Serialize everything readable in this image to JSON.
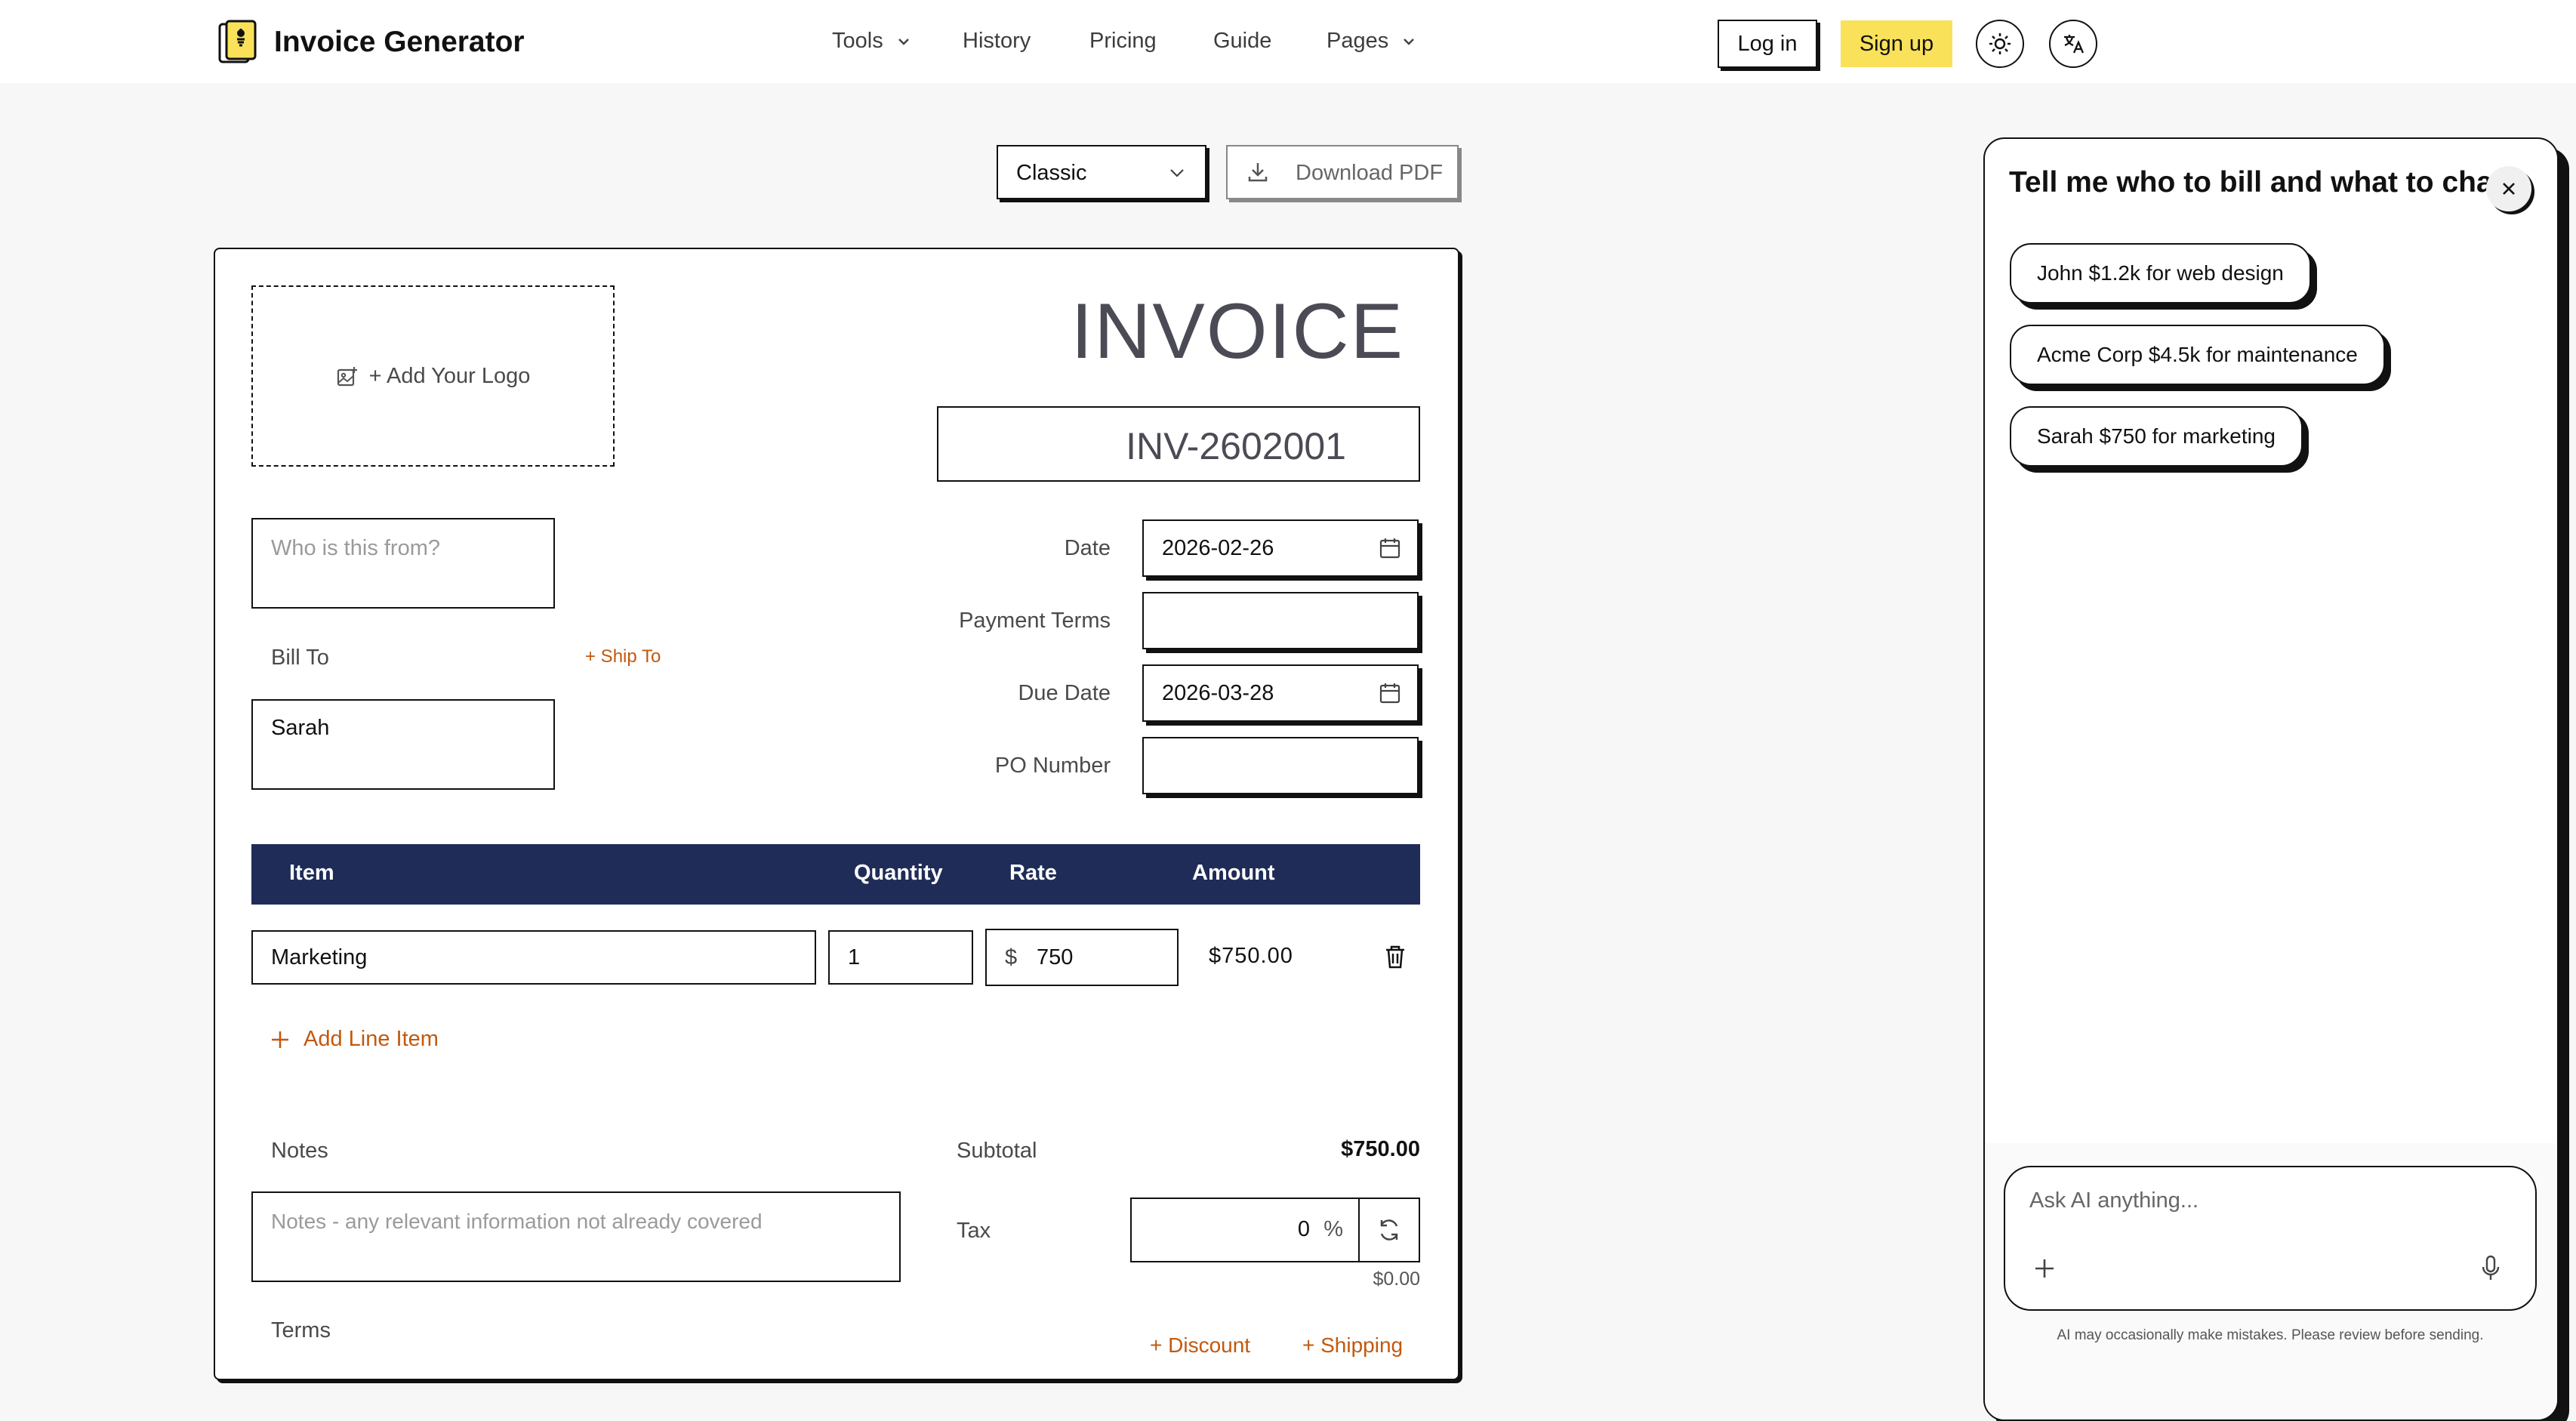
{
  "brand": {
    "name": "Invoice Generator"
  },
  "nav": {
    "items": [
      {
        "label": "Tools",
        "dropdown": true
      },
      {
        "label": "History",
        "dropdown": false
      },
      {
        "label": "Pricing",
        "dropdown": false
      },
      {
        "label": "Guide",
        "dropdown": false
      },
      {
        "label": "Pages",
        "dropdown": true
      }
    ],
    "login_label": "Log in",
    "signup_label": "Sign up",
    "theme_icon": "sun-icon",
    "language_icon": "translate-icon"
  },
  "toolbar": {
    "template_selected": "Classic",
    "download_label": "Download PDF"
  },
  "invoice": {
    "heading": "INVOICE",
    "number": "INV-2602001",
    "logo_label": "+ Add Your Logo",
    "from_placeholder": "Who is this from?",
    "bill_to_label": "Bill To",
    "ship_to_label": "+ Ship To",
    "bill_to_value": "Sarah",
    "date_label": "Date",
    "date_value": "2026-02-26",
    "payment_terms_label": "Payment Terms",
    "payment_terms_value": "",
    "due_date_label": "Due Date",
    "due_date_value": "2026-03-28",
    "po_number_label": "PO Number",
    "po_number_value": "",
    "table_headers": {
      "item": "Item",
      "quantity": "Quantity",
      "rate": "Rate",
      "amount": "Amount"
    },
    "line_items": [
      {
        "item": "Marketing",
        "quantity": "1",
        "currency": "$",
        "rate": "750",
        "amount": "$750.00"
      }
    ],
    "add_line_label": "Add Line Item",
    "notes_label": "Notes",
    "notes_placeholder": "Notes - any relevant information not already covered",
    "terms_label": "Terms",
    "subtotal_label": "Subtotal",
    "subtotal_value": "$750.00",
    "tax_label": "Tax",
    "tax_value": "0",
    "tax_unit": "%",
    "tax_amount": "$0.00",
    "discount_label": "+ Discount",
    "shipping_label": "+ Shipping"
  },
  "assistant": {
    "title": "Tell me who to bill and what to charge",
    "suggestions": [
      "John $1.2k for web design",
      "Acme Corp $4.5k for maintenance",
      "Sarah $750 for marketing"
    ],
    "input_placeholder": "Ask AI anything...",
    "disclaimer": "AI may occasionally make mistakes. Please review before sending."
  },
  "colors": {
    "accent_yellow": "#f9e15a",
    "table_header_navy": "#1f2c58",
    "link_orange": "#c2590e",
    "page_bg": "#f7f7f7"
  }
}
